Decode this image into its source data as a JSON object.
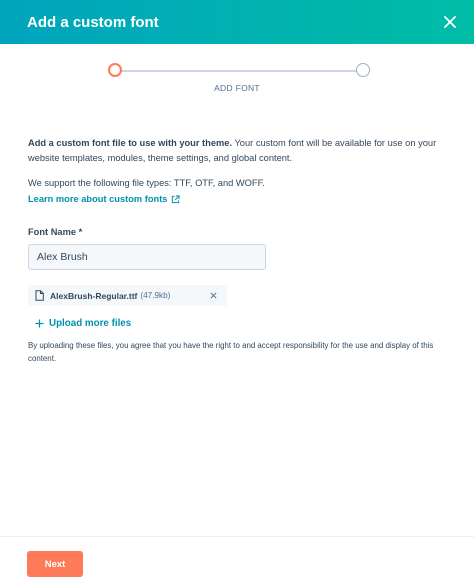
{
  "modal": {
    "title": "Add a custom font"
  },
  "stepper": {
    "current_step_label": "ADD FONT"
  },
  "body": {
    "intro_bold": "Add a custom font file to use with your theme.",
    "intro_rest": " Your custom font will be available for use on your website templates, modules, theme settings, and global content.",
    "supported_types": "We support the following file types: TTF, OTF, and WOFF.",
    "learn_more_link": "Learn more about custom fonts"
  },
  "form": {
    "font_name_label": "Font Name *",
    "font_name_value": "Alex Brush"
  },
  "uploaded_file": {
    "name": "AlexBrush-Regular.ttf",
    "size": "(47.9kb)"
  },
  "upload_more_label": "Upload more files",
  "disclaimer": "By uploading these files, you agree that you have the right to and accept responsibility for the use and display of this content.",
  "footer": {
    "next_label": "Next"
  },
  "colors": {
    "header_start": "#00a4bd",
    "header_end": "#00bda5",
    "accent_orange": "#ff7a59",
    "link": "#0091ae",
    "text": "#33475b"
  }
}
